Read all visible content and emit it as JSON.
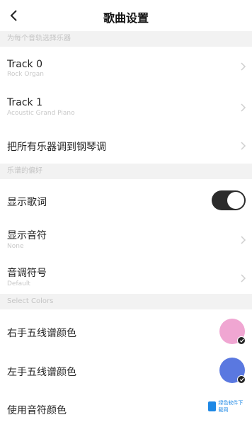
{
  "header": {
    "title": "歌曲设置"
  },
  "sections": {
    "instrument": "为每个音轨选择乐器",
    "preferences": "乐谱的偏好",
    "colors": "Select Colors"
  },
  "tracks": [
    {
      "label": "Track 0",
      "sub": "Rock Organ"
    },
    {
      "label": "Track 1",
      "sub": "Acoustic Grand Piano"
    }
  ],
  "piano_all": {
    "label": "把所有乐器调到钢琴调"
  },
  "lyrics": {
    "label": "显示歌词",
    "enabled": true
  },
  "notes": {
    "label": "显示音符",
    "sub": "None"
  },
  "key_sig": {
    "label": "音调符号",
    "sub": "Default"
  },
  "colors": {
    "right_hand": {
      "label": "右手五线谱颜色",
      "color": "#f0a6d2"
    },
    "left_hand": {
      "label": "左手五线谱颜色",
      "color": "#5a78e0"
    },
    "note_color": {
      "label": "使用音符颜色"
    }
  },
  "watermark": {
    "text": "绿色软件下载网"
  }
}
